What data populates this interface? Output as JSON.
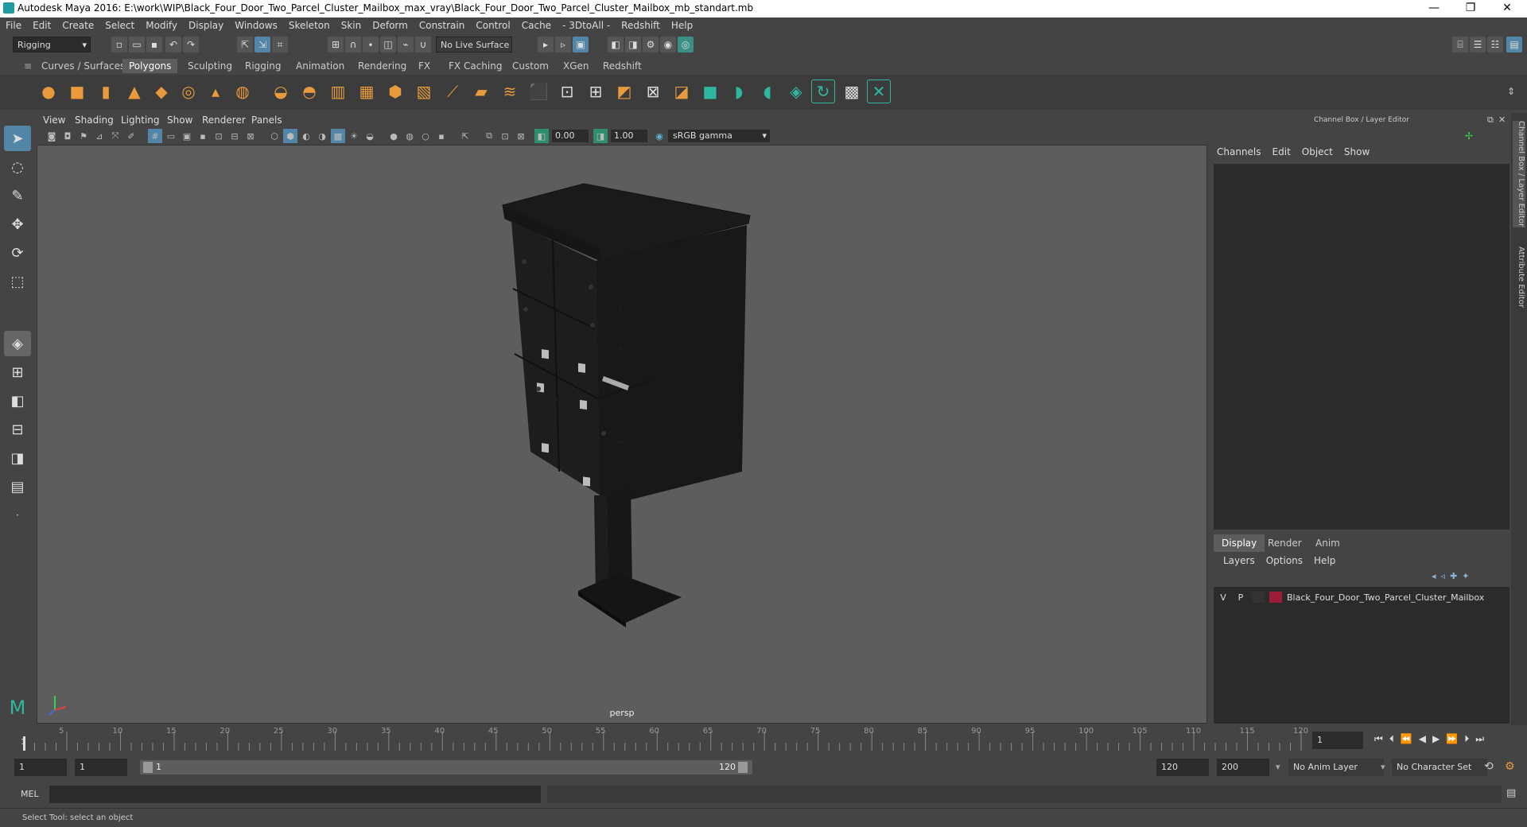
{
  "title": "Autodesk Maya 2016: E:\\work\\WIP\\Black_Four_Door_Two_Parcel_Cluster_Mailbox_max_vray\\Black_Four_Door_Two_Parcel_Cluster_Mailbox_mb_standart.mb",
  "window_controls": {
    "minimize": "—",
    "restore": "❐",
    "close": "✕"
  },
  "menu": [
    "File",
    "Edit",
    "Create",
    "Select",
    "Modify",
    "Display",
    "Windows",
    "Skeleton",
    "Skin",
    "Deform",
    "Constrain",
    "Control",
    "Cache",
    "- 3DtoAll -",
    "Redshift",
    "Help"
  ],
  "status": {
    "mode": "Rigging",
    "live_surface": "No Live Surface"
  },
  "shelf_tabs": [
    "Curves / Surfaces",
    "Polygons",
    "Sculpting",
    "Rigging",
    "Animation",
    "Rendering",
    "FX",
    "FX Caching",
    "Custom",
    "XGen",
    "Redshift"
  ],
  "shelf_active": "Polygons",
  "panel_menu": [
    "View",
    "Shading",
    "Lighting",
    "Show",
    "Renderer",
    "Panels"
  ],
  "panel_toolbar": {
    "exposure": "0.00",
    "gamma": "1.00",
    "colorspace": "sRGB gamma"
  },
  "viewport": {
    "camera_label": "persp",
    "mailbox_numbers": [
      "1",
      "2",
      "3",
      "4",
      "1P",
      "2P"
    ]
  },
  "channel_box": {
    "title": "Channel Box / Layer Editor",
    "menu": [
      "Channels",
      "Edit",
      "Object",
      "Show"
    ]
  },
  "layer_editor": {
    "tabs": [
      "Display",
      "Render",
      "Anim"
    ],
    "active_tab": "Display",
    "menu": [
      "Layers",
      "Options",
      "Help"
    ],
    "layers": [
      {
        "v": "V",
        "p": "P",
        "name": "Black_Four_Door_Two_Parcel_Cluster_Mailbox",
        "color": "#9b1d3a"
      }
    ]
  },
  "side_tabs": [
    "Channel Box / Layer Editor",
    "Attribute Editor"
  ],
  "timeline": {
    "ticks": [
      "5",
      "10",
      "15",
      "20",
      "25",
      "30",
      "35",
      "40",
      "45",
      "50",
      "55",
      "60",
      "65",
      "70",
      "75",
      "80",
      "85",
      "90",
      "95",
      "100",
      "105",
      "110",
      "115",
      "120"
    ],
    "start_label": "1",
    "current_frame": "1"
  },
  "range": {
    "start": "1",
    "playback_start": "1",
    "slider_start": "1",
    "slider_end": "120",
    "playback_end": "120",
    "end": "200",
    "anim_layer": "No Anim Layer",
    "character_set": "No Character Set"
  },
  "mel": {
    "label": "MEL"
  },
  "help_line": "Select Tool: select an object"
}
